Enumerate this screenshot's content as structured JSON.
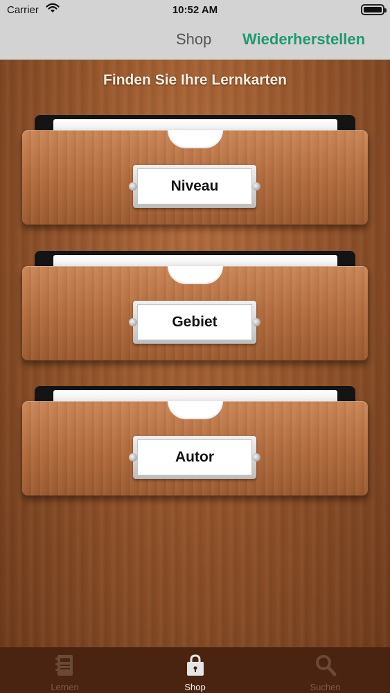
{
  "status_bar": {
    "carrier": "Carrier",
    "time": "10:52 AM"
  },
  "nav": {
    "shop_label": "Shop",
    "restore_label": "Wiederherstellen"
  },
  "main": {
    "heading": "Finden Sie Ihre Lernkarten",
    "drawers": [
      {
        "label": "Niveau"
      },
      {
        "label": "Gebiet"
      },
      {
        "label": "Autor"
      }
    ]
  },
  "tabbar": {
    "tabs": [
      {
        "label": "Lernen",
        "icon": "notebook-icon",
        "active": false
      },
      {
        "label": "Shop",
        "icon": "lock-bag-icon",
        "active": true
      },
      {
        "label": "Suchen",
        "icon": "search-icon",
        "active": false
      }
    ]
  },
  "colors": {
    "accent": "#1f9a6e",
    "tabbar_bg": "#4a2410",
    "nav_bg": "#d3d3d3"
  }
}
